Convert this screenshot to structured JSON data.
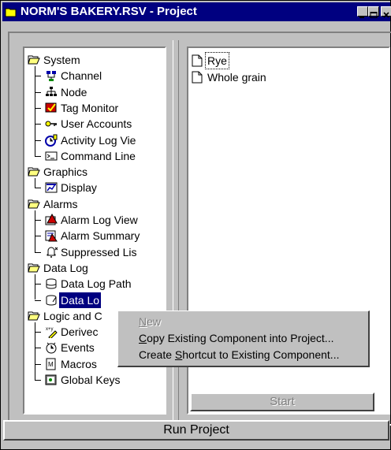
{
  "window": {
    "title": "NORM'S BAKERY.RSV - Project"
  },
  "tree": [
    {
      "label": "System",
      "icon": "folder-open-icon",
      "level": 0
    },
    {
      "label": "Channel",
      "icon": "channel-icon",
      "level": 1
    },
    {
      "label": "Node",
      "icon": "node-icon",
      "level": 1
    },
    {
      "label": "Tag Monitor",
      "icon": "tag-monitor-icon",
      "level": 1
    },
    {
      "label": "User Accounts",
      "icon": "key-icon",
      "level": 1
    },
    {
      "label": "Activity Log Vie",
      "icon": "activity-log-icon",
      "level": 1
    },
    {
      "label": "Command Line",
      "icon": "command-line-icon",
      "level": 1
    },
    {
      "label": "Graphics",
      "icon": "folder-open-icon",
      "level": 0
    },
    {
      "label": "Display",
      "icon": "display-icon",
      "level": 1
    },
    {
      "label": "Alarms",
      "icon": "folder-open-icon",
      "level": 0
    },
    {
      "label": "Alarm Log View",
      "icon": "alarm-log-icon",
      "level": 1
    },
    {
      "label": "Alarm Summary",
      "icon": "alarm-summary-icon",
      "level": 1
    },
    {
      "label": "Suppressed Lis",
      "icon": "suppressed-bell-icon",
      "level": 1
    },
    {
      "label": "Data Log",
      "icon": "folder-open-icon",
      "level": 0
    },
    {
      "label": "Data Log Path",
      "icon": "data-log-path-icon",
      "level": 1
    },
    {
      "label": "Data Lo",
      "icon": "data-log-icon",
      "level": 1,
      "selected": true
    },
    {
      "label": "Logic and C",
      "icon": "folder-open-icon",
      "level": 0
    },
    {
      "label": "Derivec",
      "icon": "derived-tags-icon",
      "level": 1
    },
    {
      "label": "Events",
      "icon": "events-icon",
      "level": 1
    },
    {
      "label": "Macros",
      "icon": "macros-icon",
      "level": 1
    },
    {
      "label": "Global Keys",
      "icon": "global-keys-icon",
      "level": 1
    }
  ],
  "list": [
    {
      "label": "Rye",
      "icon": "document-icon"
    },
    {
      "label": "Whole grain",
      "icon": "document-icon"
    }
  ],
  "buttons": {
    "start": "Start",
    "run_project": "Run Project"
  },
  "context_menu": [
    {
      "pre": "",
      "key": "N",
      "post": "ew",
      "disabled": true
    },
    {
      "pre": "",
      "key": "C",
      "post": "opy Existing Component into Project...",
      "disabled": false
    },
    {
      "pre": "Create ",
      "key": "S",
      "post": "hortcut to Existing Component...",
      "disabled": false
    }
  ],
  "colors": {
    "titlebar": "#000080",
    "face": "#c0c0c0",
    "selection": "#000080"
  }
}
